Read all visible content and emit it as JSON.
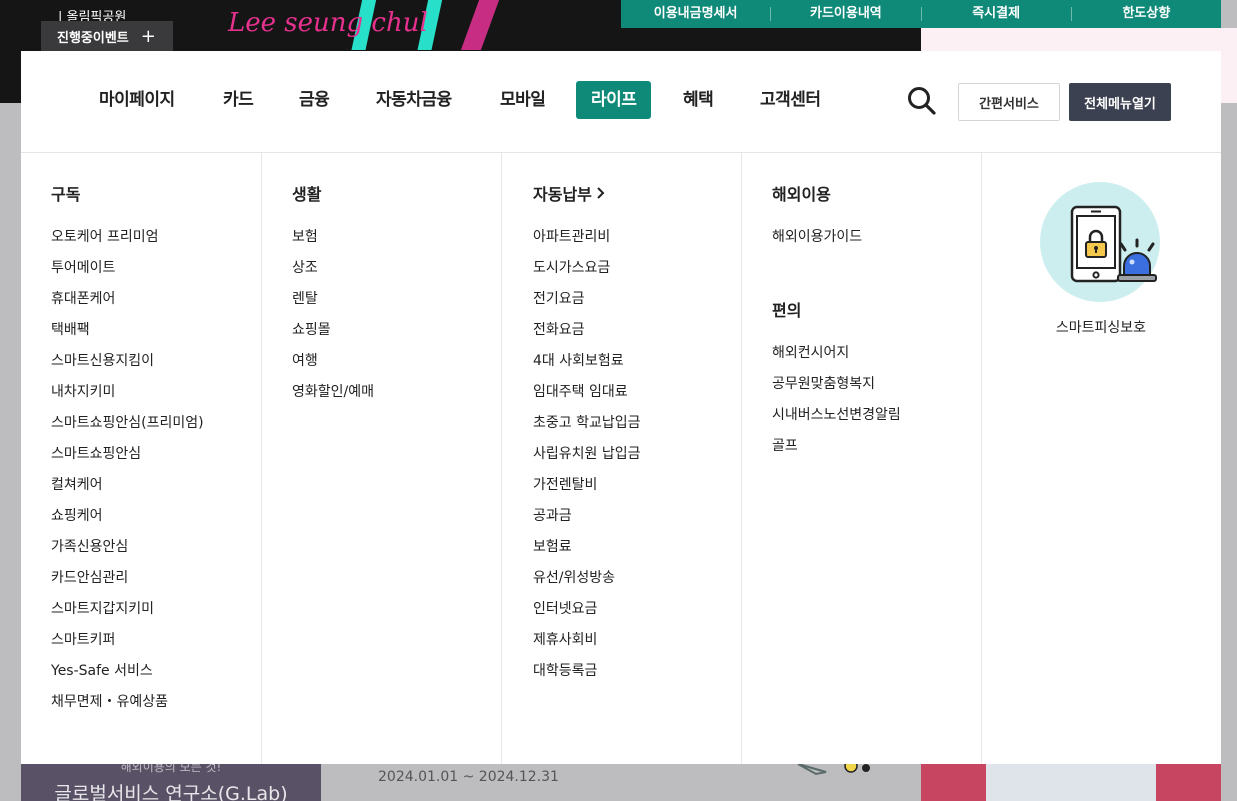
{
  "background": {
    "hero_subtitle": "| 올림픽공원",
    "hero_script": "Lee seung chul",
    "event_button": "진행중이벤트",
    "quick_links": [
      "이용내금명세서",
      "카드이용내역",
      "즉시결제",
      "한도상향"
    ],
    "lab_teaser": "해외이용의 모든 것!",
    "lab_title": "글로벌서비스 연구소(G.Lab)",
    "lab_date": "2024.01.01 ~ 2024.12.31"
  },
  "nav": {
    "items": [
      {
        "label": "마이페이지",
        "active": false
      },
      {
        "label": "카드",
        "active": false
      },
      {
        "label": "금융",
        "active": false
      },
      {
        "label": "자동차금융",
        "active": false
      },
      {
        "label": "모바일",
        "active": false
      },
      {
        "label": "라이프",
        "active": true
      },
      {
        "label": "혜택",
        "active": false
      },
      {
        "label": "고객센터",
        "active": false
      }
    ],
    "easy_service": "간편서비스",
    "full_menu": "전체메뉴열기"
  },
  "columns": [
    {
      "sections": [
        {
          "title": "구독",
          "has_arrow": false,
          "items": [
            "오토케어 프리미엄",
            "투어메이트",
            "휴대폰케어",
            "택배팩",
            "스마트신용지킴이",
            "내차지키미",
            "스마트쇼핑안심(프리미엄)",
            "스마트쇼핑안심",
            "컬쳐케어",
            "쇼핑케어",
            "가족신용안심",
            "카드안심관리",
            "스마트지갑지키미",
            "스마트키퍼",
            "Yes-Safe 서비스",
            "채무면제・유예상품"
          ]
        }
      ]
    },
    {
      "sections": [
        {
          "title": "생활",
          "has_arrow": false,
          "items": [
            "보험",
            "상조",
            "렌탈",
            "쇼핑몰",
            "여행",
            "영화할인/예매"
          ]
        }
      ]
    },
    {
      "sections": [
        {
          "title": "자동납부",
          "has_arrow": true,
          "items": [
            "아파트관리비",
            "도시가스요금",
            "전기요금",
            "전화요금",
            "4대 사회보험료",
            "임대주택 임대료",
            "초중고 학교납입금",
            "사립유치원 납입금",
            "가전렌탈비",
            "공과금",
            "보험료",
            "유선/위성방송",
            "인터넷요금",
            "제휴사회비",
            "대학등록금"
          ]
        }
      ]
    },
    {
      "sections": [
        {
          "title": "해외이용",
          "has_arrow": false,
          "items": [
            "해외이용가이드"
          ]
        },
        {
          "title": "편의",
          "has_arrow": false,
          "items": [
            "해외컨시어지",
            "공무원맞춤형복지",
            "시내버스노선변경알림",
            "골프"
          ]
        }
      ]
    }
  ],
  "promo": {
    "label": "스마트피싱보호",
    "icon": "phone-lock-siren-icon"
  },
  "colors": {
    "accent": "#0f8a79",
    "dark_button": "#3b4150",
    "promo_circle": "#cdeeef"
  }
}
